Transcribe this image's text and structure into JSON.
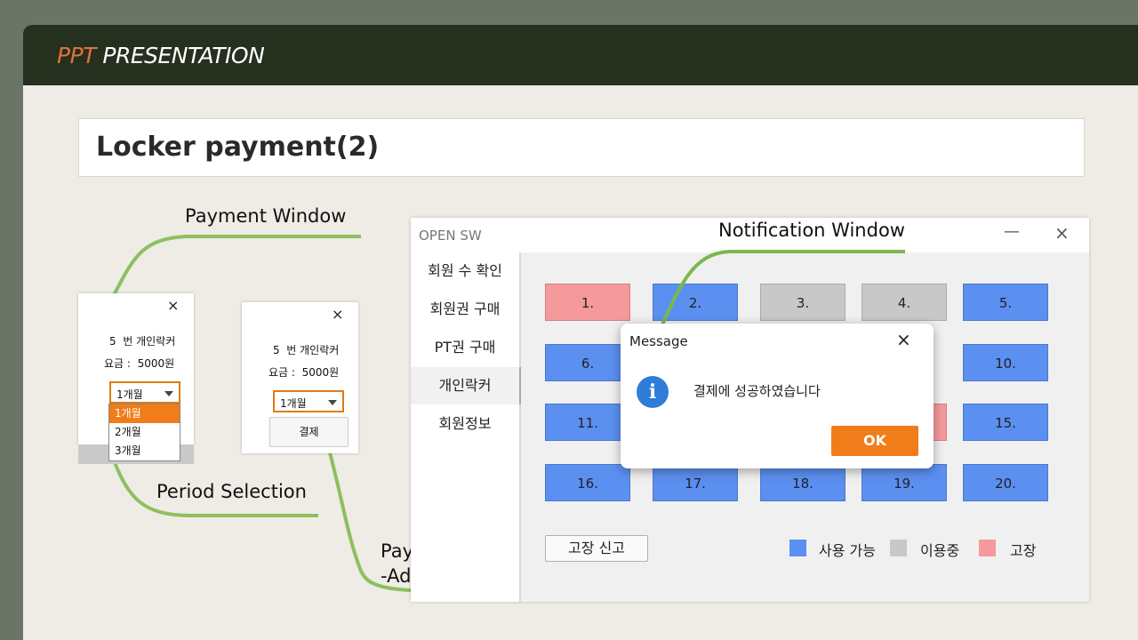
{
  "banner": {
    "prefix": "PPT",
    "suffix": "PRESENTATION",
    "accent_color": "#e0733a"
  },
  "slide_title": "Locker payment(2)",
  "captions": {
    "payment_window": "Payment Window",
    "period_selection": "Period Selection",
    "payment_button_line1": "Payment button",
    "payment_button_line2": "-Added to DB",
    "notification_window": "Notification Window"
  },
  "dialog1": {
    "close": "×",
    "locker_no": "5",
    "locker_text": "번 개인락커",
    "fee_label": "요금 :",
    "fee_value": "5000원",
    "period_selected": "1개월",
    "period_options": [
      "1개월",
      "2개월",
      "3개월"
    ]
  },
  "dialog2": {
    "close": "×",
    "locker_no": "5",
    "locker_text": "번 개인락커",
    "fee_label": "요금 :",
    "fee_value": "5000원",
    "period_selected": "1개월",
    "pay_button": "결제"
  },
  "app": {
    "title": "OPEN SW",
    "minimize": "—",
    "close": "×",
    "sidebar": [
      "회원 수 확인",
      "회원권 구매",
      "PT권 구매",
      "개인락커",
      "회원정보"
    ],
    "active_sidebar": "개인락커",
    "lockers": [
      {
        "label": "1.",
        "status": "broken"
      },
      {
        "label": "2.",
        "status": "available"
      },
      {
        "label": "3.",
        "status": "in-use"
      },
      {
        "label": "4.",
        "status": "in-use"
      },
      {
        "label": "5.",
        "status": "available"
      },
      {
        "label": "6.",
        "status": "available"
      },
      {
        "label": "10.",
        "status": "available"
      },
      {
        "label": "11.",
        "status": "available"
      },
      {
        "label": "15.",
        "status": "available"
      },
      {
        "label": "16.",
        "status": "available"
      },
      {
        "label": "17.",
        "status": "available"
      },
      {
        "label": "18.",
        "status": "available"
      },
      {
        "label": "19.",
        "status": "available"
      },
      {
        "label": "20.",
        "status": "available"
      }
    ],
    "status_colors": {
      "available": "#5b8ff0",
      "in-use": "#c8c8c8",
      "broken": "#f5999c"
    },
    "report_button": "고장 신고",
    "legend": [
      {
        "label": "사용 가능",
        "status": "available"
      },
      {
        "label": "이용중",
        "status": "in-use"
      },
      {
        "label": "고장",
        "status": "broken"
      }
    ]
  },
  "message": {
    "title": "Message",
    "close": "×",
    "text": "결제에 성공하였습니다",
    "ok": "OK",
    "ok_color": "#f07d1a"
  }
}
